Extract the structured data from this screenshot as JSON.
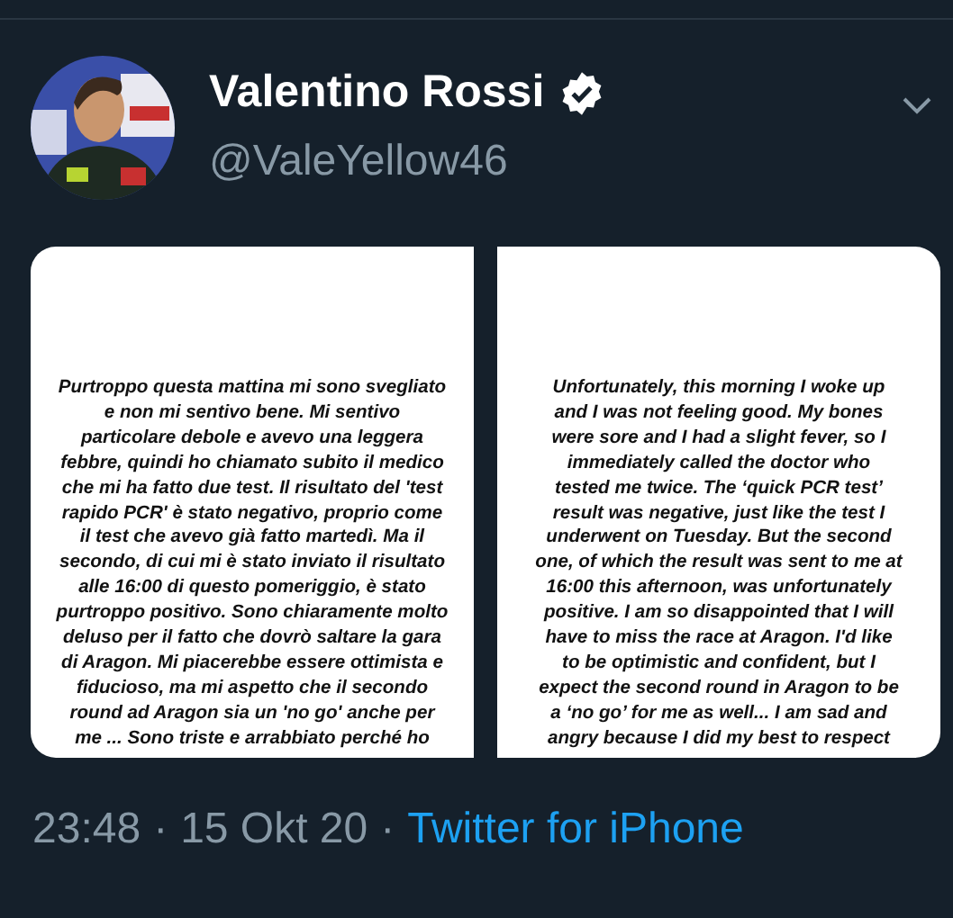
{
  "author": {
    "name": "Valentino Rossi",
    "verified": true,
    "handle": "@ValeYellow46"
  },
  "images": [
    {
      "lines": [
        "Purtroppo questa mattina mi sono svegliato",
        "e non mi sentivo bene. Mi sentivo",
        "particolare debole e avevo una leggera",
        "febbre, quindi ho chiamato subito il medico",
        "che mi ha fatto due test. Il risultato del 'test",
        "rapido PCR' è stato negativo, proprio come",
        "il test che avevo già fatto martedì. Ma il",
        "secondo, di cui mi è stato inviato il risultato",
        "alle 16:00 di questo pomeriggio, è stato",
        "purtroppo positivo. Sono chiaramente molto",
        "deluso per il fatto che dovrò saltare la gara",
        "di Aragon. Mi piacerebbe essere ottimista e",
        "fiducioso, ma mi aspetto che il secondo",
        "round ad Aragon sia un 'no go' anche per",
        "me ... Sono triste e arrabbiato perché ho"
      ]
    },
    {
      "lines": [
        "Unfortunately, this morning I woke up",
        "and I was not feeling good. My bones",
        "were sore and I had a slight fever, so I",
        "immediately called the doctor who",
        "tested me twice. The ‘quick PCR test’",
        "result was negative, just like the test I",
        "underwent on Tuesday. But the second",
        "one, of which the result was sent to me at",
        "16:00 this afternoon, was unfortunately",
        "positive. I am so disappointed that I will",
        "have to miss the race at Aragon. I'd like",
        "to be optimistic and confident, but I",
        "expect the second round in Aragon to be",
        "a ‘no go’ for me as well... I am sad and",
        "angry because I did my best to respect"
      ]
    }
  ],
  "footer": {
    "time": "23:48",
    "separator_1": "·",
    "date": "15 Okt 20",
    "separator_2": "·",
    "source": "Twitter for iPhone"
  }
}
